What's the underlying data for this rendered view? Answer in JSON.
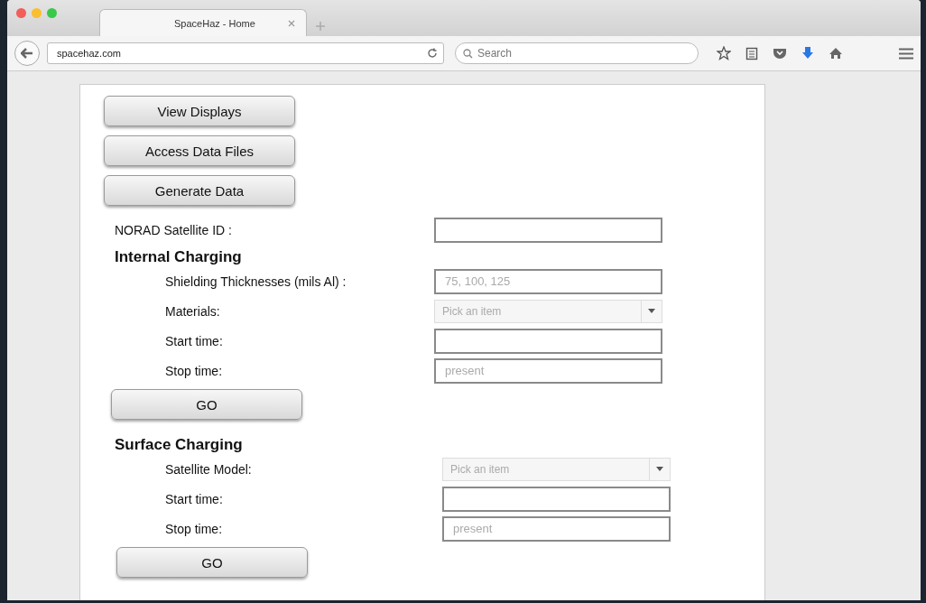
{
  "browser": {
    "tab_title": "SpaceHaz - Home",
    "url": "spacehaz.com",
    "search_placeholder": "Search"
  },
  "nav_buttons": [
    "View Displays",
    "Access Data Files",
    "Generate Data"
  ],
  "satellite_id": {
    "label": "NORAD Satellite ID :",
    "kind": "text"
  },
  "sections": [
    {
      "title": "Internal Charging",
      "fields": [
        {
          "label": "Shielding Thicknesses (mils Al) :",
          "kind": "text",
          "placeholder": "75, 100, 125"
        },
        {
          "label": "Materials:",
          "kind": "dropdown",
          "placeholder": "Pick an item"
        },
        {
          "label": "Start time:",
          "kind": "text"
        },
        {
          "label": "Stop time:",
          "kind": "text",
          "placeholder": "present"
        }
      ],
      "button": "GO"
    },
    {
      "title": "Surface Charging",
      "fields": [
        {
          "label": "Satellite Model:",
          "kind": "dropdown",
          "placeholder": "Pick an item"
        },
        {
          "label": "Start time:",
          "kind": "text"
        },
        {
          "label": "Stop time:",
          "kind": "text",
          "placeholder": "present"
        }
      ],
      "button": "GO"
    }
  ]
}
